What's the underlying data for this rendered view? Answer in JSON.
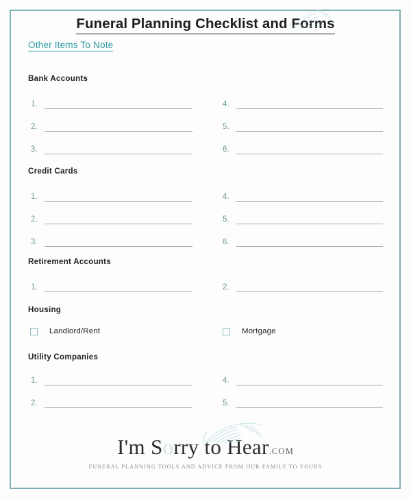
{
  "document": {
    "title": "Funeral Planning Checklist and Forms",
    "subtitle": "Other Items To Note"
  },
  "theme": {
    "border_color": "#7fb0b3",
    "accent_color": "#2e9aa3",
    "number_color": "#6f9a9c",
    "rule_color": "#a9a9a9",
    "checkbox_border": "#8fbcbe",
    "heading_color": "#1f1f22",
    "page_background": "#fdfdfd"
  },
  "sections": [
    {
      "heading": "Bank Accounts",
      "type": "numbered-lines",
      "left_items": [
        "1.",
        "2.",
        "3."
      ],
      "right_items": [
        "4.",
        "5.",
        "6."
      ]
    },
    {
      "heading": "Credit Cards",
      "type": "numbered-lines",
      "left_items": [
        "1.",
        "2.",
        "3."
      ],
      "right_items": [
        "4.",
        "5.",
        "6."
      ]
    },
    {
      "heading": "Retirement Accounts",
      "type": "numbered-lines",
      "left_items": [
        "1."
      ],
      "right_items": [
        "2."
      ]
    },
    {
      "heading": "Housing",
      "type": "checkboxes",
      "left_items": [
        "Landlord/Rent"
      ],
      "right_items": [
        "Mortgage"
      ]
    },
    {
      "heading": "Utility Companies",
      "type": "numbered-lines",
      "left_items": [
        "1.",
        "2."
      ],
      "right_items": [
        "4.",
        "5."
      ]
    }
  ],
  "footer": {
    "logo_part1": "I'm S",
    "logo_o": "o",
    "logo_part2": "rry to Hear",
    "logo_tld": ".COM",
    "tagline": "FUNERAL PLANNING TOOLS AND ADVICE FROM OUR FAMILY TO YOURS"
  },
  "layout": {
    "section_tops": [
      108,
      243,
      375,
      445,
      514
    ],
    "row_start_offsets": [
      35,
      35,
      35,
      30,
      32
    ],
    "row_gap": 33,
    "check_gap": 0
  }
}
